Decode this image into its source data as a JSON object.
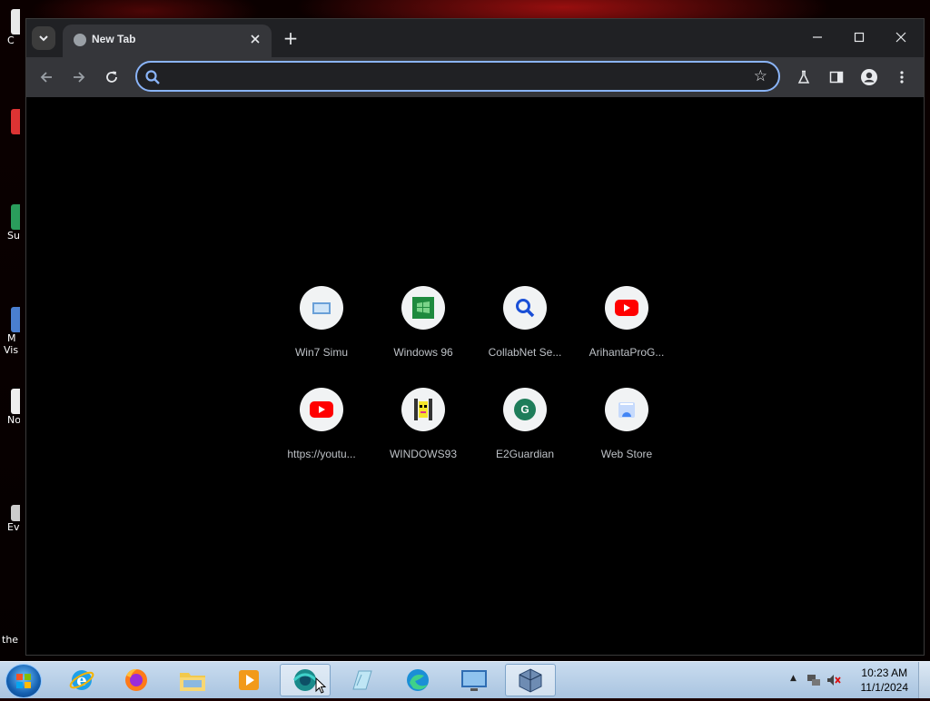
{
  "desktop": {
    "icons": [
      {
        "label": "C"
      },
      {
        "label": ""
      },
      {
        "label": "Su"
      },
      {
        "label": "M"
      },
      {
        "label": "Vis"
      },
      {
        "label": "No"
      },
      {
        "label": "Ev"
      },
      {
        "label": "the"
      }
    ]
  },
  "browser": {
    "tab": {
      "title": "New Tab",
      "close_icon": "close-icon"
    },
    "new_tab_label": "+",
    "omnibox": {
      "value": "",
      "placeholder": ""
    },
    "shortcuts": [
      {
        "label": "Win7 Simu",
        "icon": "windows-icon"
      },
      {
        "label": "Windows 96",
        "icon": "windows96-icon"
      },
      {
        "label": "CollabNet Se...",
        "icon": "search-icon"
      },
      {
        "label": "ArihantaProG...",
        "icon": "youtube-icon"
      },
      {
        "label": "https://youtu...",
        "icon": "youtube-icon"
      },
      {
        "label": "WINDOWS93",
        "icon": "windows93-icon"
      },
      {
        "label": "E2Guardian",
        "icon": "letter-g-icon",
        "letter": "G"
      },
      {
        "label": "Web Store",
        "icon": "webstore-icon"
      }
    ]
  },
  "taskbar": {
    "apps": [
      "internet-explorer",
      "firefox",
      "file-explorer",
      "media-player",
      "chrome",
      "notepad",
      "edge",
      "remote-desktop",
      "virtualbox"
    ],
    "clock": {
      "time": "10:23 AM",
      "date": "11/1/2024"
    }
  },
  "colors": {
    "accent": "#8ab4f8",
    "youtube_red": "#ff0000",
    "tab_bg": "#35363a",
    "frame_bg": "#202124"
  }
}
